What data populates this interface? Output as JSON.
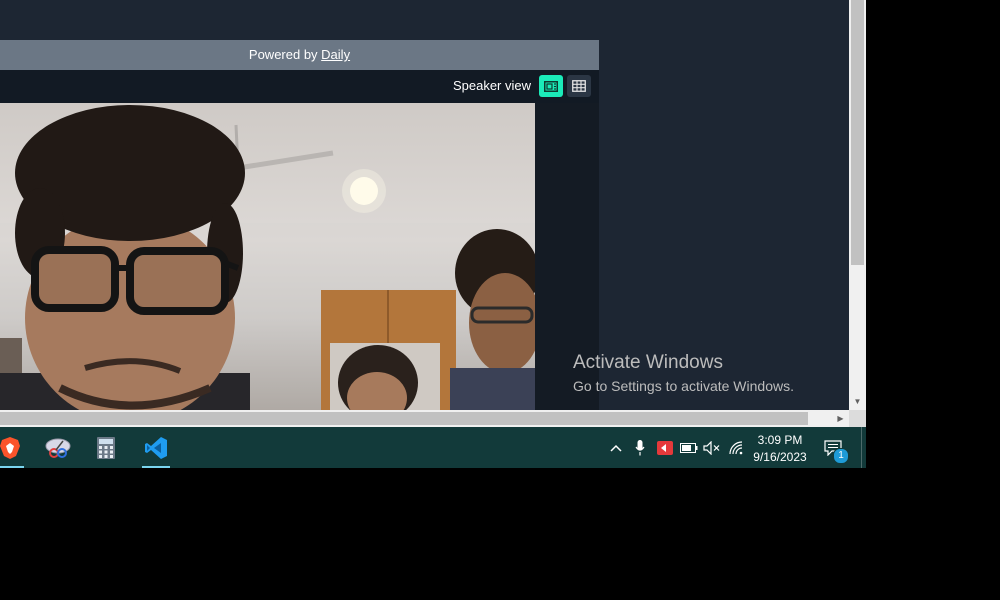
{
  "call": {
    "powered_prefix": "Powered by ",
    "powered_link": "Daily",
    "view_label": "Speaker view"
  },
  "watermark": {
    "title": "Activate Windows",
    "subtitle": "Go to Settings to activate Windows."
  },
  "taskbar": {
    "apps": [
      {
        "name": "brave-browser-icon",
        "active": true
      },
      {
        "name": "snipping-tool-icon",
        "active": false
      },
      {
        "name": "calculator-icon",
        "active": false
      },
      {
        "name": "vscode-icon",
        "active": true
      }
    ],
    "time": "3:09 PM",
    "date": "9/16/2023",
    "notification_count": "1"
  },
  "colors": {
    "accent": "#1bebb9",
    "taskbar": "#123a3a",
    "background": "#1d2633"
  }
}
